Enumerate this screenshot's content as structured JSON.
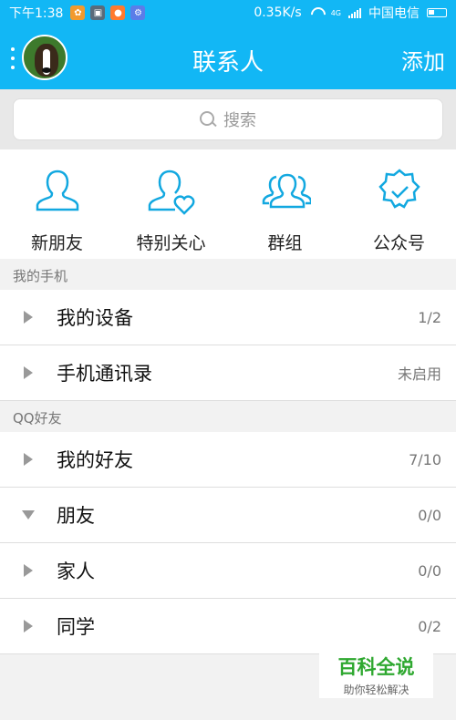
{
  "status_bar": {
    "time": "下午1:38",
    "speed": "0.35K/s",
    "network": "4G",
    "carrier": "中国电信"
  },
  "header": {
    "title": "联系人",
    "add_label": "添加"
  },
  "search": {
    "placeholder": "搜索"
  },
  "quick_actions": [
    {
      "label": "新朋友",
      "icon": "person-icon"
    },
    {
      "label": "特别关心",
      "icon": "person-heart-icon"
    },
    {
      "label": "群组",
      "icon": "group-icon"
    },
    {
      "label": "公众号",
      "icon": "badge-check-icon"
    }
  ],
  "sections": [
    {
      "title": "我的手机",
      "items": [
        {
          "label": "我的设备",
          "count": "1/2",
          "expanded": false
        },
        {
          "label": "手机通讯录",
          "count": "未启用",
          "expanded": false
        }
      ]
    },
    {
      "title": "QQ好友",
      "items": [
        {
          "label": "我的好友",
          "count": "7/10",
          "expanded": false
        },
        {
          "label": "朋友",
          "count": "0/0",
          "expanded": true
        },
        {
          "label": "家人",
          "count": "0/0",
          "expanded": false
        },
        {
          "label": "同学",
          "count": "0/2",
          "expanded": false
        }
      ]
    }
  ],
  "watermark": {
    "brand": "百科全说",
    "slogan": "助你轻松解决"
  },
  "colors": {
    "accent": "#12b7f5",
    "icon_stroke": "#12a8e0"
  }
}
